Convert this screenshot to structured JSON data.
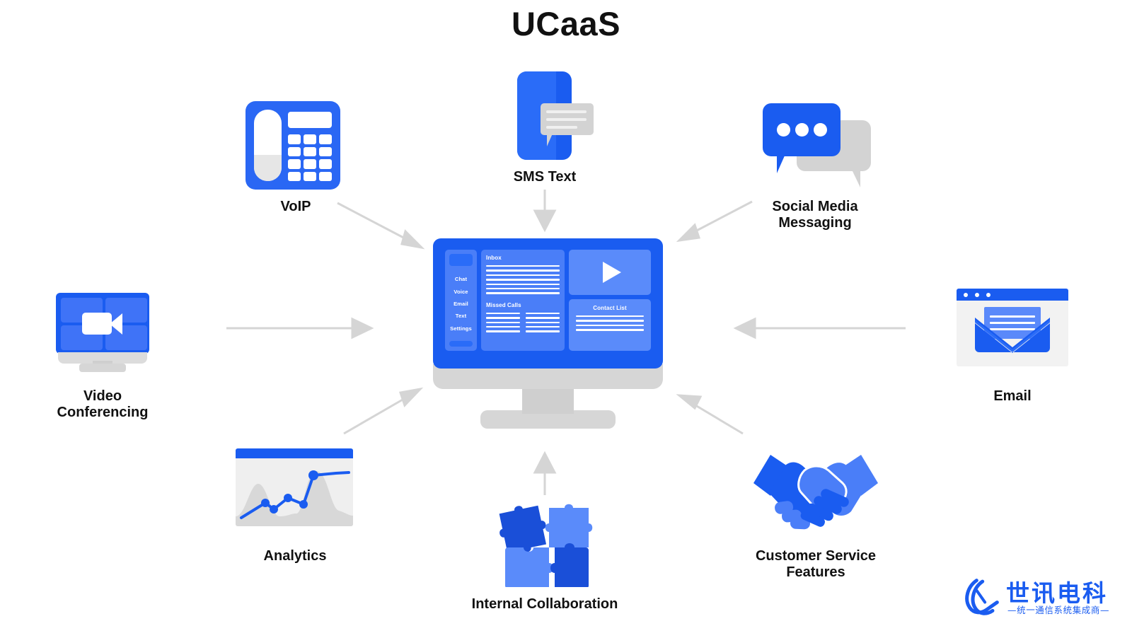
{
  "page": {
    "title": "UCaaS",
    "background_color": "#ffffff",
    "accent_blue": "#1a5cf0",
    "light_blue": "#4a7ef8",
    "pane_blue": "#5a8bfa",
    "arrow_gray": "#d5d5d5",
    "icon_gray": "#d3d3d3",
    "text_color": "#111111"
  },
  "nodes": [
    {
      "id": "voip",
      "label": "VoIP",
      "icon": "desk-phone-icon"
    },
    {
      "id": "sms",
      "label": "SMS Text",
      "icon": "phone-message-icon"
    },
    {
      "id": "social",
      "label": "Social Media\nMessaging",
      "icon": "chat-bubbles-icon"
    },
    {
      "id": "video",
      "label": "Video\nConferencing",
      "icon": "monitor-camera-icon"
    },
    {
      "id": "email",
      "label": "Email",
      "icon": "envelope-window-icon"
    },
    {
      "id": "analytics",
      "label": "Analytics",
      "icon": "line-chart-window-icon"
    },
    {
      "id": "collaboration",
      "label": "Internal Collaboration",
      "icon": "puzzle-pieces-icon"
    },
    {
      "id": "customer",
      "label": "Customer Service\nFeatures",
      "icon": "handshake-icon"
    }
  ],
  "hub": {
    "name": "UCaaS unified dashboard monitor",
    "sidebar": {
      "items": [
        "Chat",
        "Voice",
        "Email",
        "Text",
        "Settings"
      ]
    },
    "panels": {
      "inbox": {
        "title": "Inbox",
        "row_count": 7
      },
      "missed_calls": {
        "title": "Missed Calls",
        "column_count": 2,
        "rows_per_column": 5
      },
      "video": {
        "control": "play-button"
      },
      "contact_list": {
        "title": "Contact List",
        "row_count": 4
      }
    }
  },
  "arrows": {
    "color": "#d5d5d5",
    "connections": [
      {
        "from": "voip",
        "to": "hub",
        "direction": "down-right"
      },
      {
        "from": "sms",
        "to": "hub",
        "direction": "down"
      },
      {
        "from": "social",
        "to": "hub",
        "direction": "down-left"
      },
      {
        "from": "video",
        "to": "hub",
        "direction": "right"
      },
      {
        "from": "email",
        "to": "hub",
        "direction": "left"
      },
      {
        "from": "analytics",
        "to": "hub",
        "direction": "up-right"
      },
      {
        "from": "collaboration",
        "to": "hub",
        "direction": "up"
      },
      {
        "from": "customer",
        "to": "hub",
        "direction": "up-left"
      }
    ]
  },
  "watermark": {
    "company_cn": "世讯电科",
    "tagline_cn": "—统一通信系统集成商—",
    "color": "#1a5cf0"
  }
}
